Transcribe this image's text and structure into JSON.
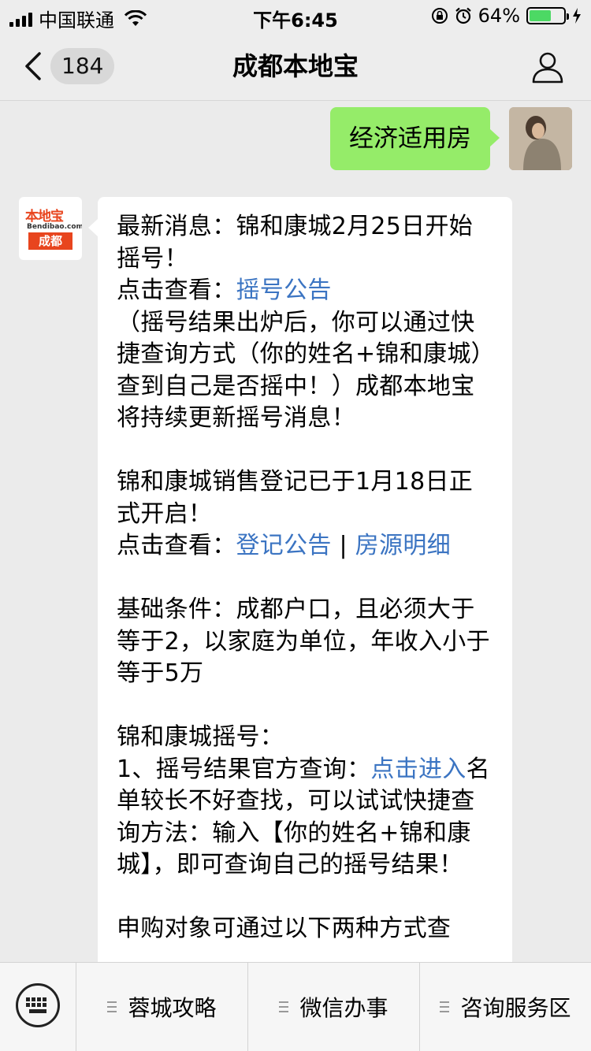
{
  "status_bar": {
    "carrier": "中国联通",
    "time": "下午6:45",
    "battery_percent": "64%",
    "battery_level": 0.64
  },
  "nav": {
    "back_count": "184",
    "title": "成都本地宝"
  },
  "chat": {
    "sent_message": "经济适用房",
    "bot_logo": {
      "brand": "本地宝",
      "domain": "Bendibao.com",
      "city": "成都"
    },
    "received": {
      "p1_line1": "最新消息：锦和康城2月25日开始摇号！",
      "p1_link_prefix": "点击查看：",
      "p1_link": "摇号公告",
      "p1_body": "（摇号结果出炉后，你可以通过快捷查询方式（你的姓名+锦和康城）查到自己是否摇中！）成都本地宝将持续更新摇号消息！",
      "p2_line1": "锦和康城销售登记已于1月18日正式开启！",
      "p2_link_prefix": "点击查看：",
      "p2_link1": "登记公告",
      "p2_sep": " | ",
      "p2_link2": "房源明细",
      "p3": "基础条件：成都户口，且必须大于等于2，以家庭为单位，年收入小于等于5万",
      "p4_title": "锦和康城摇号：",
      "p4_item_prefix": "1、摇号结果官方查询：",
      "p4_link": "点击进入",
      "p4_body": "名单较长不好查找，可以试试快捷查询方法：输入【你的姓名+锦和康城】，即可查询自己的摇号结果！",
      "p5": "申购对象可通过以下两种方式查"
    }
  },
  "bottom_menu": {
    "items": [
      "蓉城攻略",
      "微信办事",
      "咨询服务区"
    ]
  }
}
